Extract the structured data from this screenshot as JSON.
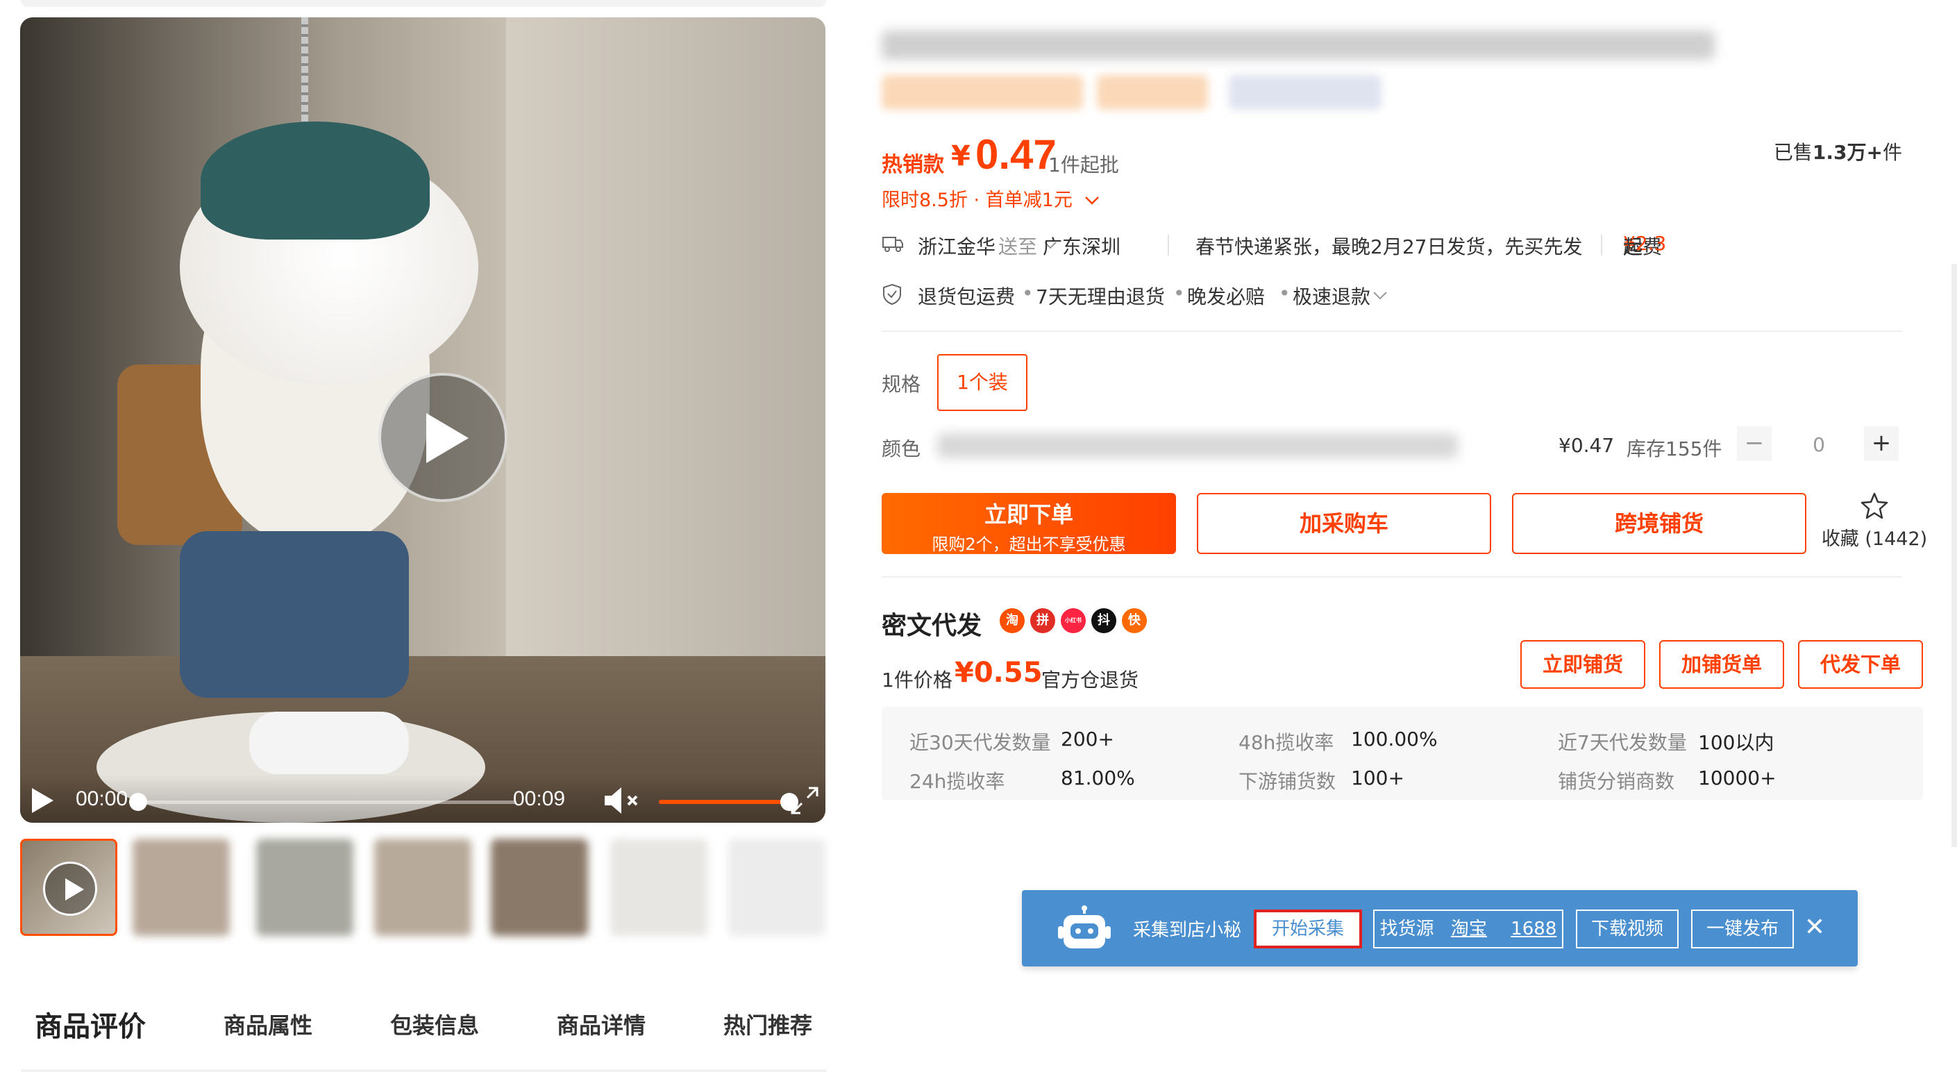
{
  "media": {
    "video": {
      "current_time": "00:00",
      "duration": "00:09",
      "progress": 0,
      "volume": 1.0
    },
    "thumbnail_count": 7
  },
  "tabs": [
    {
      "label": "商品评价",
      "active": true
    },
    {
      "label": "商品属性",
      "active": false
    },
    {
      "label": "包装信息",
      "active": false
    },
    {
      "label": "商品详情",
      "active": false
    },
    {
      "label": "热门推荐",
      "active": false
    }
  ],
  "price": {
    "hot_label": "热销款",
    "currency": "¥",
    "value": "0.47",
    "min_order": "1件起批",
    "sold_prefix": "已售",
    "sold_count": "1.3万+",
    "sold_suffix": "件",
    "promo": "限时8.5折 · 首单减1元"
  },
  "shipping": {
    "from": "浙江金华",
    "to_label": "送至",
    "to": "广东深圳",
    "notice": "春节快递紧张，最晚2月27日发货，先买先发",
    "fee_label": "运费",
    "fee": "¥2.3",
    "fee_suffix": "起"
  },
  "services": [
    "退货包运费",
    "7天无理由退货",
    "晚发必赔",
    "极速退款"
  ],
  "spec": {
    "spec_label": "规格",
    "spec_option": "1个装",
    "color_label": "颜色",
    "unit_price": "¥0.47",
    "stock": "库存155件",
    "quantity": "0",
    "minus": "−",
    "plus": "+"
  },
  "actions": {
    "buy_now": "立即下单",
    "buy_now_note": "限购2个，超出不享受优惠",
    "add_cart": "加采购车",
    "cross_border": "跨境铺货",
    "favorite": "收藏 (1442)"
  },
  "dropship": {
    "title": "密文代发",
    "platform_icons": [
      "淘",
      "拼",
      "小红书",
      "抖",
      "快"
    ],
    "platform_colors": [
      "#ff5000",
      "#e02e24",
      "#ff2442",
      "#111111",
      "#ff6a00"
    ],
    "price_label": "1件价格",
    "price": "¥0.55",
    "return": "官方仓退货",
    "buttons": [
      "立即铺货",
      "加铺货单",
      "代发下单"
    ]
  },
  "stats": [
    {
      "label": "近30天代发数量",
      "value": "200+"
    },
    {
      "label": "48h揽收率",
      "value": "100.00%"
    },
    {
      "label": "近7天代发数量",
      "value": "100以内"
    },
    {
      "label": "24h揽收率",
      "value": "81.00%"
    },
    {
      "label": "下游铺货数",
      "value": "100+"
    },
    {
      "label": "铺货分销商数",
      "value": "10000+"
    }
  ],
  "plugin": {
    "label": "采集到店小秘",
    "start": "开始采集",
    "find_source": "找货源",
    "taobao": "淘宝",
    "ali1688": "1688",
    "download_video": "下载视频",
    "publish": "一键发布",
    "close": "✕"
  },
  "colors": {
    "accent": "#ff4000",
    "plugin_bg": "#4a8fcf",
    "plugin_highlight": "#e0231f"
  }
}
